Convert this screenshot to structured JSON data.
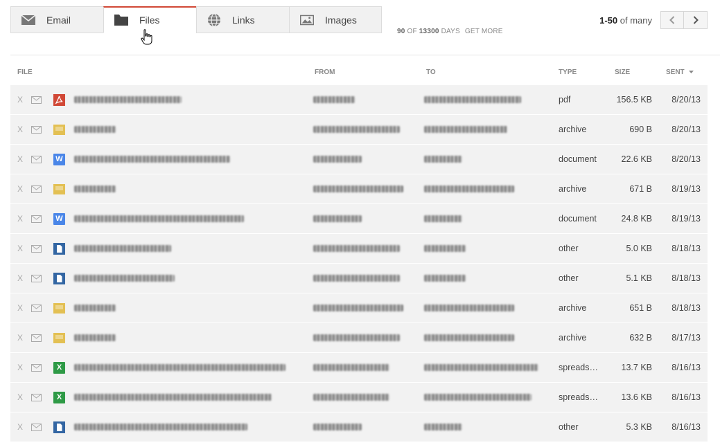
{
  "tabs": [
    {
      "label": "Email",
      "icon": "envelope-icon"
    },
    {
      "label": "Files",
      "icon": "folder-icon",
      "active": true
    },
    {
      "label": "Links",
      "icon": "globe-icon"
    },
    {
      "label": "Images",
      "icon": "image-icon"
    }
  ],
  "days_info": {
    "shown": "90",
    "of": "OF",
    "total": "13300",
    "unit": "DAYS",
    "get_more": "GET MORE"
  },
  "pager": {
    "range": "1-50",
    "of_text": "of many",
    "prev": "‹",
    "next": "›"
  },
  "columns": {
    "file": "FILE",
    "from": "FROM",
    "to": "TO",
    "type": "TYPE",
    "size": "SIZE",
    "sent": "SENT"
  },
  "delete_label": "X",
  "colors": {
    "pdf": "#d14836",
    "archive": "#e3c053",
    "document": "#4a86e8",
    "other": "#3366a3",
    "spreadsheet": "#2e9a46",
    "active_tab": "#d14836"
  },
  "rows": [
    {
      "icon": "pdf-icon",
      "type": "pdf",
      "size": "156.5 KB",
      "sent": "8/20/13",
      "fw": 155,
      "frw": 60,
      "tw": 140
    },
    {
      "icon": "archive-icon",
      "type": "archive",
      "size": "690 B",
      "sent": "8/20/13",
      "fw": 60,
      "frw": 125,
      "tw": 120
    },
    {
      "icon": "word-icon",
      "type": "document",
      "size": "22.6 KB",
      "sent": "8/20/13",
      "fw": 225,
      "frw": 70,
      "tw": 55
    },
    {
      "icon": "archive-icon",
      "type": "archive",
      "size": "671 B",
      "sent": "8/19/13",
      "fw": 60,
      "frw": 130,
      "tw": 130
    },
    {
      "icon": "word-icon",
      "type": "document",
      "size": "24.8 KB",
      "sent": "8/19/13",
      "fw": 245,
      "frw": 70,
      "tw": 55
    },
    {
      "icon": "doc-icon",
      "type": "other",
      "size": "5.0 KB",
      "sent": "8/18/13",
      "fw": 140,
      "frw": 125,
      "tw": 60
    },
    {
      "icon": "doc-icon",
      "type": "other",
      "size": "5.1 KB",
      "sent": "8/18/13",
      "fw": 145,
      "frw": 125,
      "tw": 60
    },
    {
      "icon": "archive-icon",
      "type": "archive",
      "size": "651 B",
      "sent": "8/18/13",
      "fw": 60,
      "frw": 130,
      "tw": 130
    },
    {
      "icon": "archive-icon",
      "type": "archive",
      "size": "632 B",
      "sent": "8/17/13",
      "fw": 60,
      "frw": 125,
      "tw": 130
    },
    {
      "icon": "excel-icon",
      "type": "spreads…",
      "size": "13.7 KB",
      "sent": "8/16/13",
      "fw": 305,
      "frw": 110,
      "tw": 165
    },
    {
      "icon": "excel-icon",
      "type": "spreads…",
      "size": "13.6 KB",
      "sent": "8/16/13",
      "fw": 285,
      "frw": 110,
      "tw": 155
    },
    {
      "icon": "doc-icon",
      "type": "other",
      "size": "5.3 KB",
      "sent": "8/16/13",
      "fw": 250,
      "frw": 70,
      "tw": 55
    }
  ]
}
